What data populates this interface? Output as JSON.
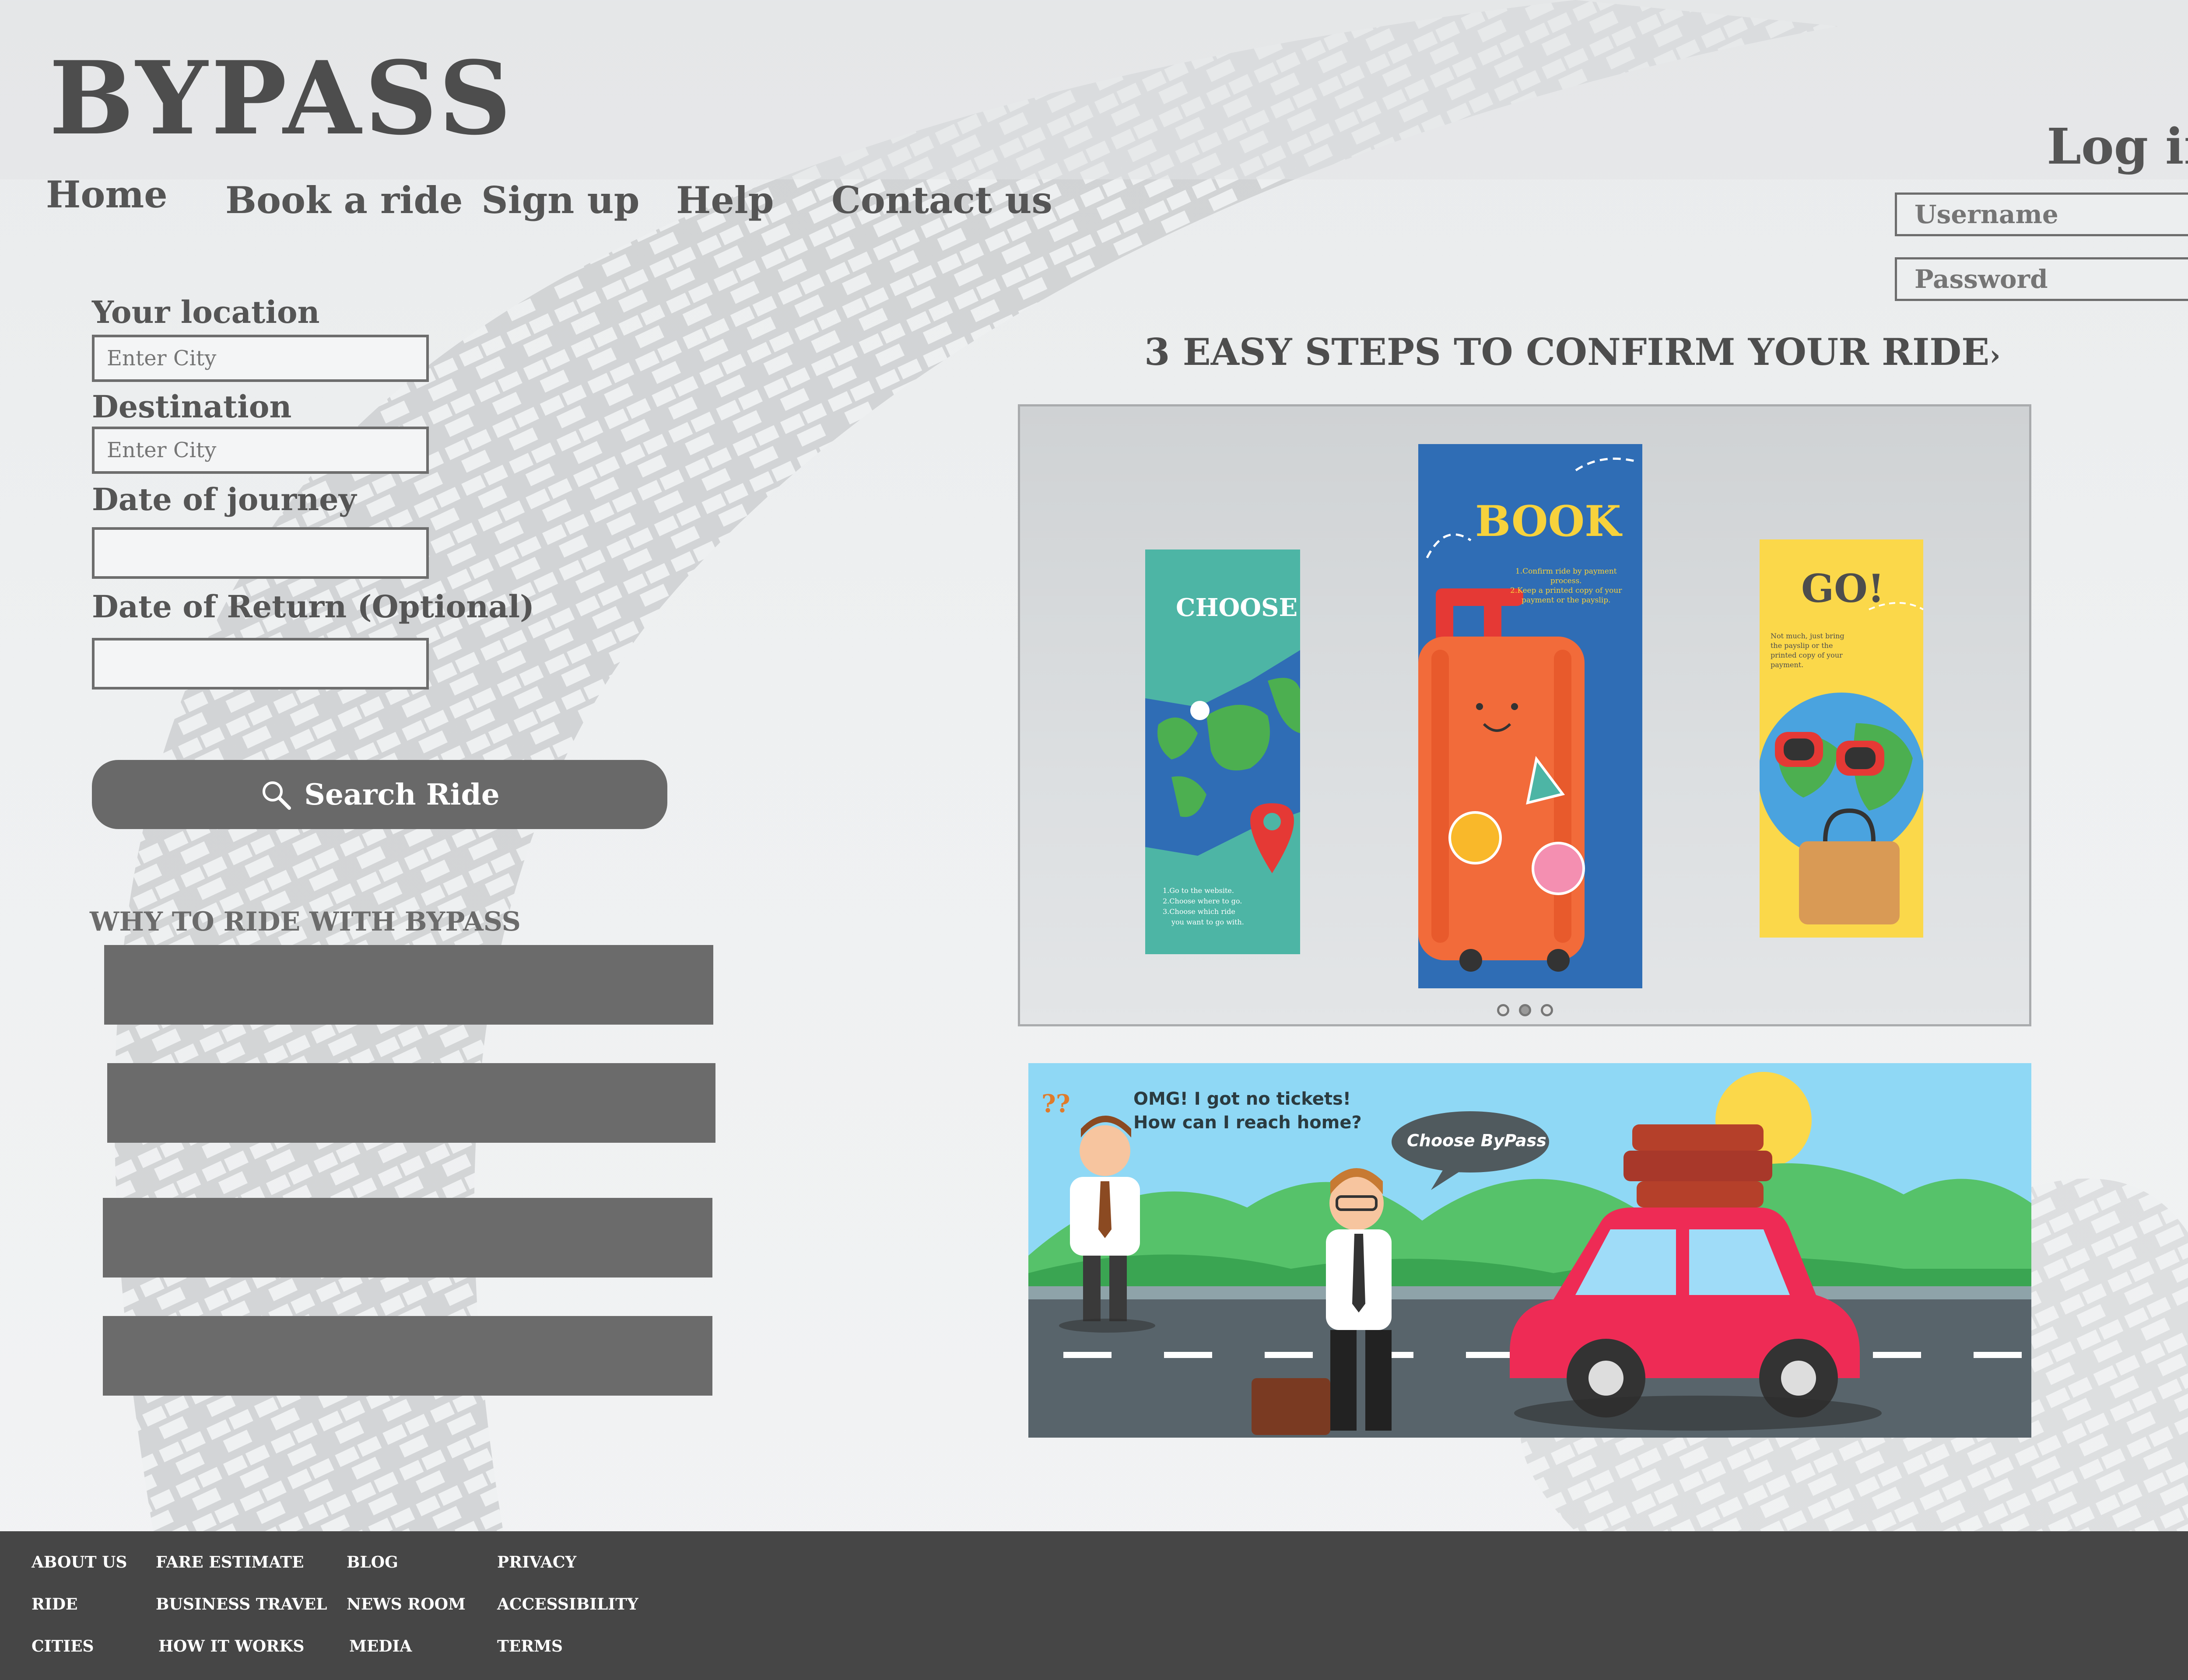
{
  "brand": {
    "logo": "BYPASS"
  },
  "nav": {
    "items": [
      "Home",
      "Book a ride",
      "Sign up",
      "Help",
      "Contact us"
    ]
  },
  "login": {
    "title": "Log in",
    "username_placeholder": "Username",
    "password_placeholder": "Password"
  },
  "search_form": {
    "location_label": "Your location",
    "location_placeholder": "Enter City",
    "destination_label": "Destination",
    "destination_placeholder": "Enter City",
    "date_label": "Date of journey",
    "return_label": "Date of Return (Optional)",
    "search_button": "Search Ride"
  },
  "why": {
    "title": "WHY TO RIDE WITH BYPASS"
  },
  "steps": {
    "title": "3 EASY STEPS TO CONFIRM YOUR RIDE",
    "arrow": "›",
    "cards": [
      {
        "heading": "CHOOSE",
        "lines": [
          "1.Go to the website.",
          "2.Choose where to go.",
          "3.Choose which ride",
          "you want to go with."
        ]
      },
      {
        "heading": "BOOK",
        "lines": [
          "1.Confirm ride by payment",
          "process.",
          "2.Keep a printed copy of your",
          "payment or the payslip."
        ]
      },
      {
        "heading": "GO!",
        "lines": [
          "Not much, just bring",
          "the payslip or the",
          "printed copy of your",
          "payment."
        ]
      }
    ],
    "active_index": 1
  },
  "banner": {
    "speech_confused": "OMG! I got no tickets!\nHow can I reach home?",
    "speech_confused_line1": "OMG! I got no tickets!",
    "speech_confused_line2": "How can I reach home?",
    "speech_choose": "Choose ByPass",
    "question_marks": "??"
  },
  "footer": {
    "columns": [
      [
        "ABOUT US",
        "RIDE",
        "CITIES"
      ],
      [
        "FARE ESTIMATE",
        "BUSINESS TRAVEL",
        "HOW  IT WORKS"
      ],
      [
        "BLOG",
        "NEWS ROOM",
        "MEDIA"
      ],
      [
        "PRIVACY",
        "ACCESSIBILITY",
        "TERMS"
      ]
    ]
  },
  "colors": {
    "background": "#eceeef",
    "text": "#4d4d4d",
    "button": "#696969",
    "footer": "#464646",
    "card_choose": "#4db5a5",
    "card_book": "#2f6db5",
    "card_go": "#fbd84a",
    "book_heading": "#f7d23c",
    "banner_sky": "#8fd8f5"
  },
  "icons": {
    "search": "search-icon"
  }
}
